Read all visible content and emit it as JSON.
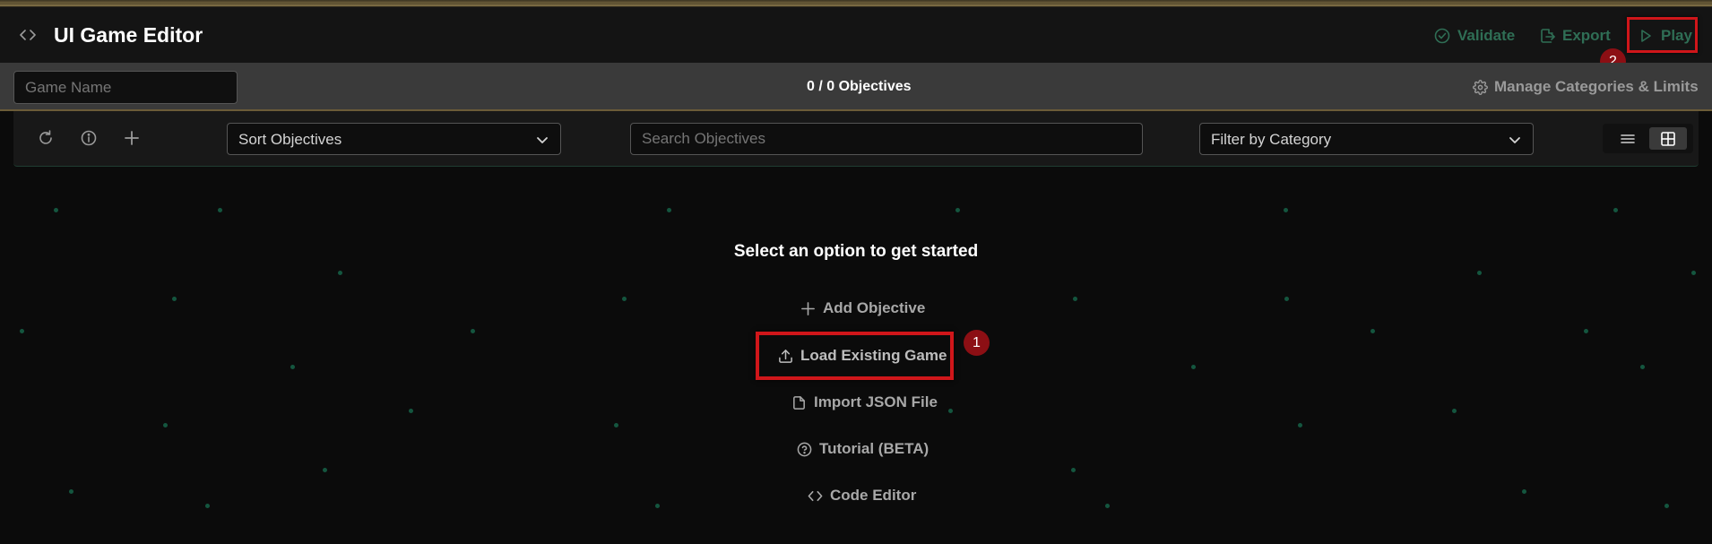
{
  "header": {
    "title": "UI Game Editor",
    "validate_label": "Validate",
    "export_label": "Export",
    "play_label": "Play"
  },
  "subbar": {
    "game_name_placeholder": "Game Name",
    "objectives_count": "0 / 0 Objectives",
    "manage_label": "Manage Categories & Limits"
  },
  "toolbar": {
    "sort_label": "Sort Objectives",
    "search_placeholder": "Search Objectives",
    "filter_label": "Filter by Category"
  },
  "main": {
    "prompt": "Select an option to get started",
    "options": {
      "add": "Add Objective",
      "load": "Load Existing Game",
      "import": "Import JSON File",
      "tutorial": "Tutorial (BETA)",
      "code": "Code Editor"
    }
  },
  "annotations": {
    "badge_1": "1",
    "badge_2": "2"
  },
  "colors": {
    "accent_green": "#2f6e55",
    "highlight_red": "#d0161a",
    "badge_red": "#8c0f14",
    "gold": "#6b5c38"
  }
}
